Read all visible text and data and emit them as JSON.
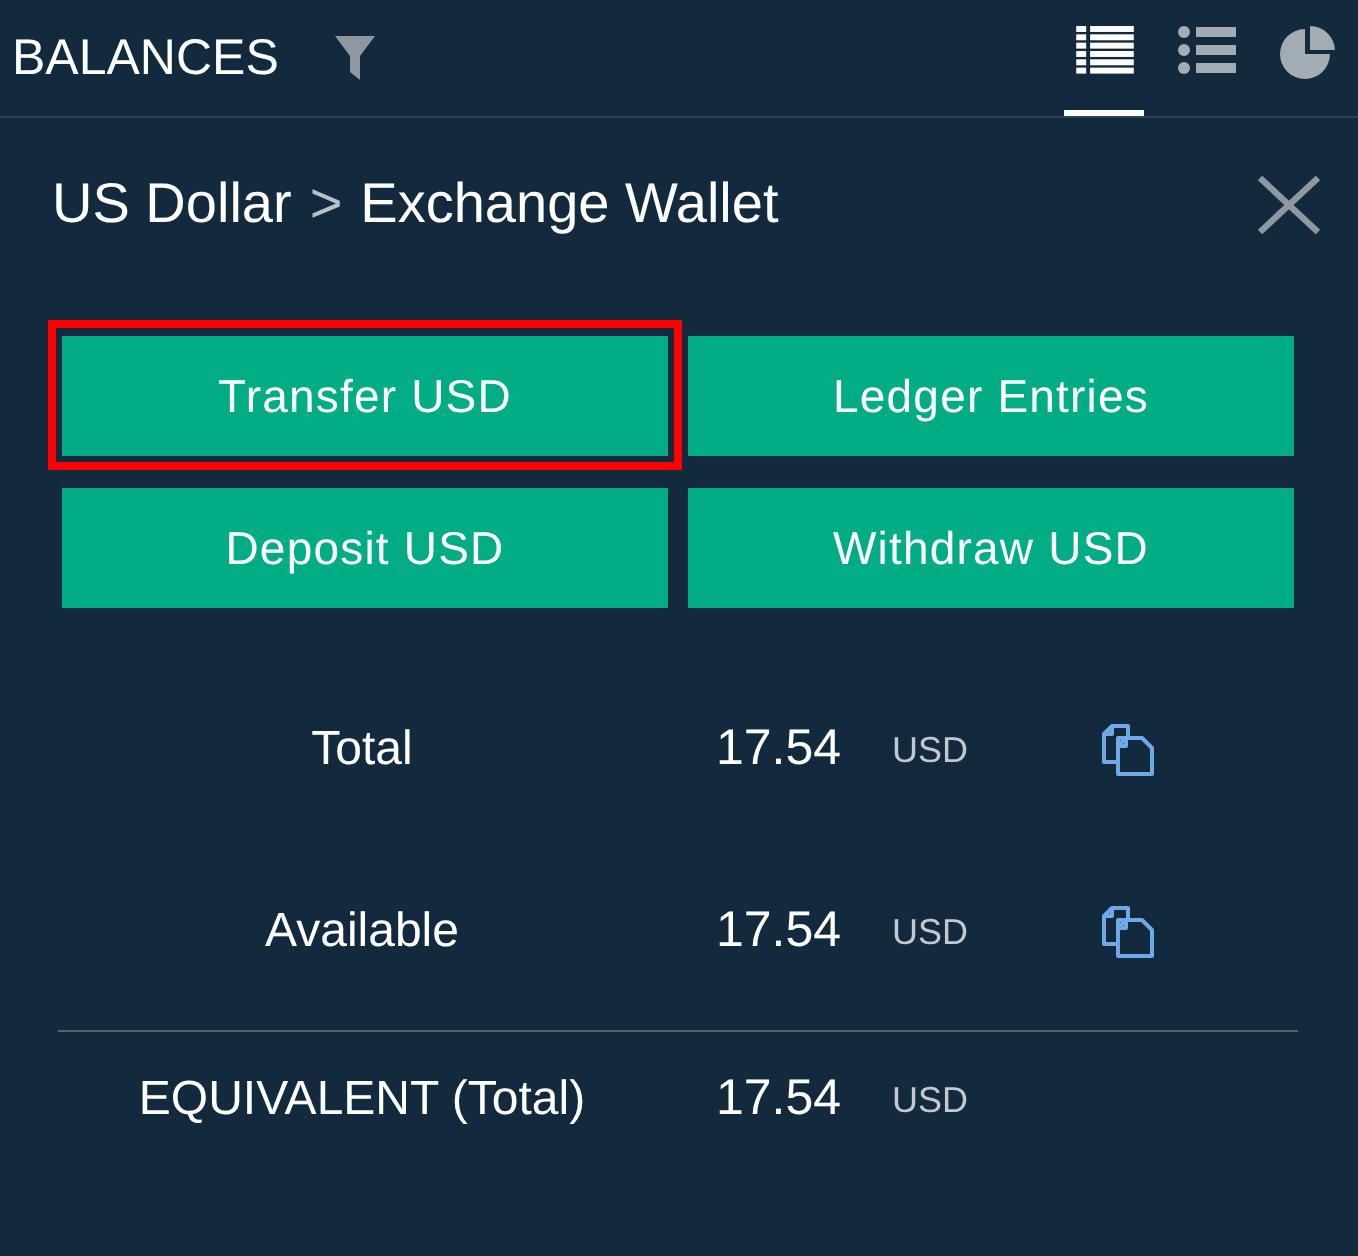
{
  "header": {
    "title": "BALANCES",
    "view_tabs": [
      {
        "kind": "table",
        "selected": true
      },
      {
        "kind": "list",
        "selected": false
      },
      {
        "kind": "pie",
        "selected": false
      }
    ]
  },
  "breadcrumb": {
    "currency": "US Dollar",
    "separator": ">",
    "wallet": "Exchange Wallet"
  },
  "actions": [
    {
      "label": "Transfer USD",
      "highlighted": true
    },
    {
      "label": "Ledger Entries",
      "highlighted": false
    },
    {
      "label": "Deposit USD",
      "highlighted": false
    },
    {
      "label": "Withdraw USD",
      "highlighted": false
    }
  ],
  "balances": [
    {
      "label": "Total",
      "amount": "17.54",
      "currency": "USD",
      "copyable": true
    },
    {
      "label": "Available",
      "amount": "17.54",
      "currency": "USD",
      "copyable": true
    }
  ],
  "equivalent": {
    "label": "EQUIVALENT (Total)",
    "amount": "17.54",
    "currency": "USD"
  }
}
